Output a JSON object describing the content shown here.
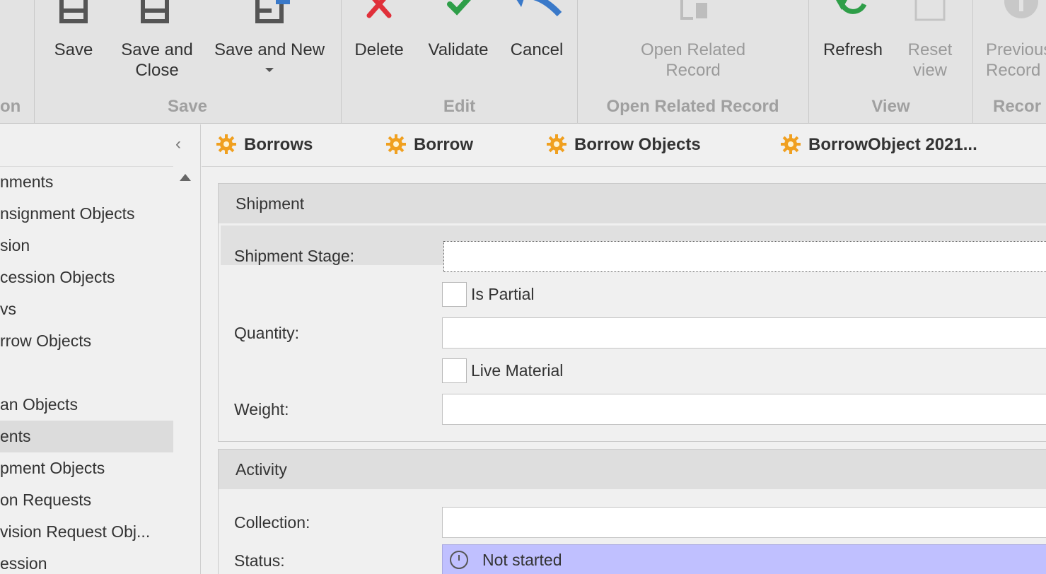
{
  "ribbon": {
    "groups": {
      "navigation_partial": "on",
      "save": "Save",
      "edit": "Edit",
      "open_related": "Open Related Record",
      "view": "View",
      "records_partial": "Recor"
    },
    "buttons": {
      "save": "Save",
      "save_close": "Save and\nClose",
      "save_new": "Save and New",
      "delete": "Delete",
      "validate": "Validate",
      "cancel": "Cancel",
      "open_related": "Open Related\nRecord",
      "refresh": "Refresh",
      "reset_view": "Reset\nview",
      "previous_record": "Previous\nRecord"
    },
    "colors": {
      "delete": "#e0303a",
      "validate": "#2e9e48",
      "cancel": "#3a79c9",
      "refresh": "#2e9e48"
    }
  },
  "sidebar": {
    "items": [
      {
        "label": "nments"
      },
      {
        "label": "nsignment Objects"
      },
      {
        "label": "sion"
      },
      {
        "label": "cession Objects"
      },
      {
        "label": "vs"
      },
      {
        "label": "rrow Objects"
      },
      {
        "label": ""
      },
      {
        "label": "an Objects"
      },
      {
        "label": "ents"
      },
      {
        "label": "pment Objects"
      },
      {
        "label": "on Requests"
      },
      {
        "label": "vision Request Obj..."
      },
      {
        "label": "ession"
      }
    ]
  },
  "tabs": [
    {
      "label": "Borrows",
      "icon": "gear-icon"
    },
    {
      "label": "Borrow",
      "icon": "gear-icon"
    },
    {
      "label": "Borrow Objects",
      "icon": "gear-icon"
    },
    {
      "label": "BorrowObject 2021...",
      "icon": "gear-icon"
    }
  ],
  "shipment": {
    "title": "Shipment",
    "stage_label": "Shipment Stage:",
    "stage_value": "",
    "is_partial_label": "Is Partial",
    "quantity_label": "Quantity:",
    "quantity_value": "",
    "live_material_label": "Live Material",
    "weight_label": "Weight:",
    "weight_value": ""
  },
  "activity": {
    "title": "Activity",
    "collection_label": "Collection:",
    "collection_value": "",
    "status_label": "Status:",
    "status_value": "Not started",
    "status_color": "#c0c0ff"
  }
}
